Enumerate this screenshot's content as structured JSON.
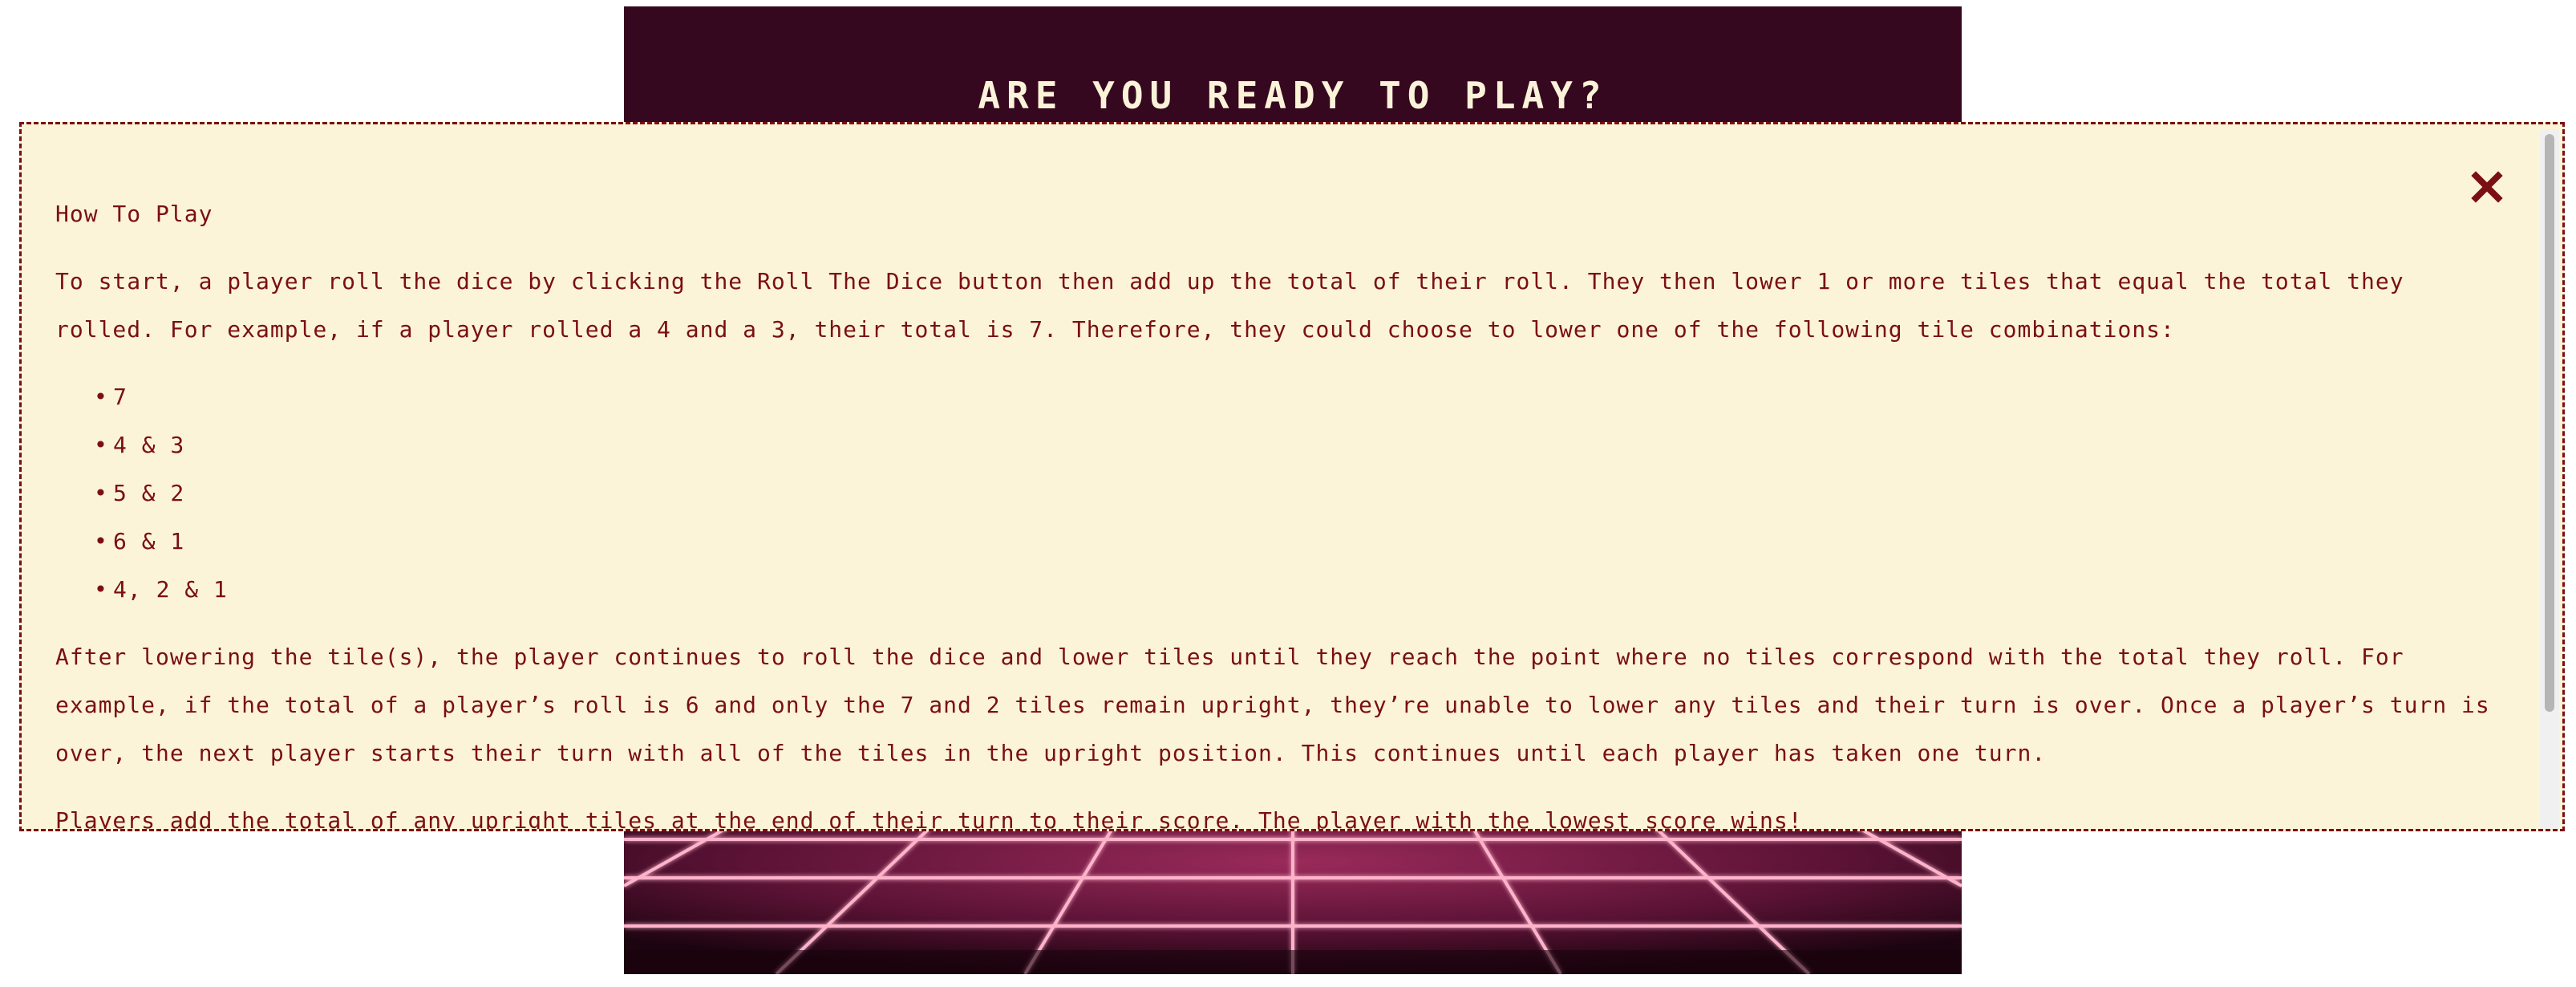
{
  "game": {
    "title": "ARE YOU READY TO PLAY?"
  },
  "modal": {
    "title": "How To Play",
    "close_icon": "close-icon",
    "intro": "To start, a player roll the dice by clicking the Roll The Dice button then add up the total of their roll. They then lower 1 or more tiles that equal the total they rolled. For example, if a player rolled a 4 and a 3, their total is 7. Therefore, they could choose to lower one of the following tile combinations:",
    "combinations": [
      "7",
      "4 & 3",
      "5 & 2",
      "6 & 1",
      "4, 2 & 1"
    ],
    "continuation": "After lowering the tile(s), the player continues to roll the dice and lower tiles until they reach the point where no tiles correspond with the total they roll. For example, if the total of a player’s roll is 6 and only the 7 and 2 tiles remain upright, they’re unable to lower any tiles and their turn is over. Once a player’s turn is over, the next player starts their turn with all of the tiles in the upright position. This continues until each player has taken one turn.",
    "scoring": "Players add the total of any upright tiles at the end of their turn to their score. The player with the lowest score wins!"
  },
  "colors": {
    "panel_bg": "#36081f",
    "modal_bg": "#fcf4d8",
    "accent": "#7a0f14",
    "grid_glow": "#ff9fbf"
  }
}
